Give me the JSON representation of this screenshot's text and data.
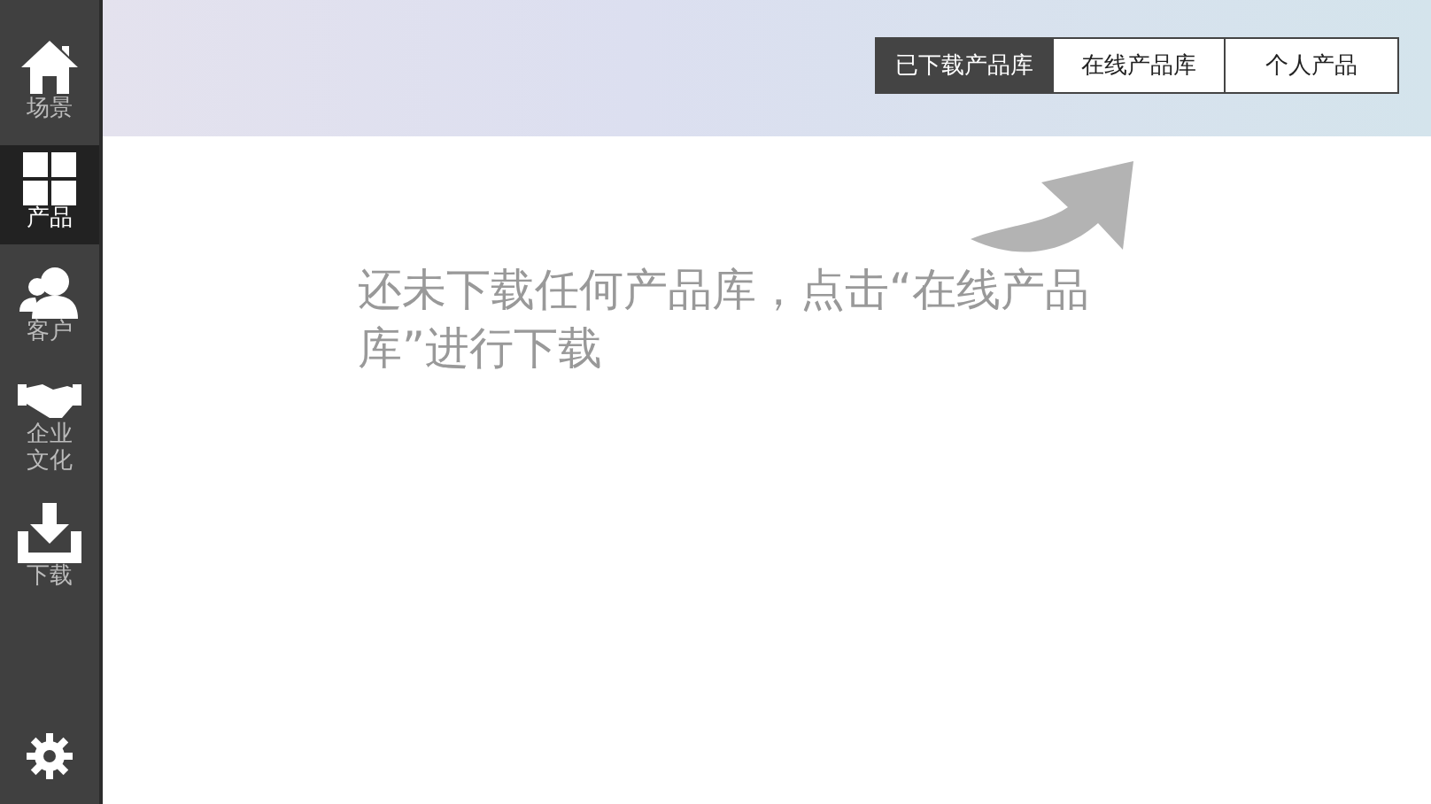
{
  "sidebar": {
    "items": [
      {
        "label": "场景",
        "selected": false
      },
      {
        "label": "产品",
        "selected": true
      },
      {
        "label": "客户",
        "selected": false
      },
      {
        "label": "企业文化",
        "selected": false
      },
      {
        "label": "下载",
        "selected": false
      }
    ]
  },
  "tabs": [
    {
      "label": "已下载产品库",
      "selected": true
    },
    {
      "label": "在线产品库",
      "selected": false
    },
    {
      "label": "个人产品",
      "selected": false
    }
  ],
  "message": "还未下载任何产品库，点击“在线产品库”进行下载"
}
